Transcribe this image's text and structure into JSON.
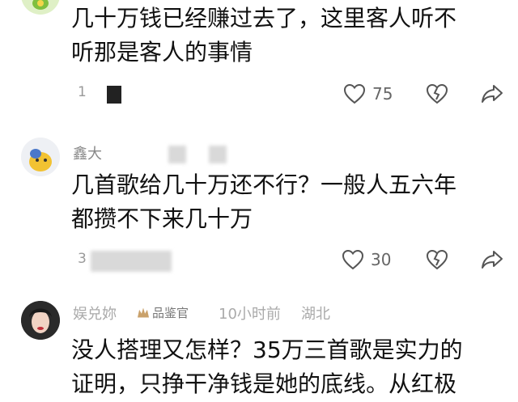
{
  "comments": [
    {
      "text_line1": "几十万钱已经赚过去了，这里客人听不",
      "text_line2": "听那是客人的事情",
      "meta_fragment": "1",
      "likes": "75"
    },
    {
      "username": "鑫大",
      "text_line1": "几首歌给几十万还不行？一般人五六年",
      "text_line2": "都攒不下来几十万",
      "meta_fragment": "3",
      "likes": "30"
    },
    {
      "username": "娱兑妳",
      "badge": "品鉴官",
      "time": "10小时前",
      "location": "湖北",
      "text_line1": "没人搭理又怎样？35万三首歌是实力的",
      "text_line2": "证明，只挣干净钱是她的底线。从红极"
    }
  ],
  "icons": {
    "like": "heart-icon",
    "dislike": "broken-heart-icon",
    "share": "share-arrow-icon"
  }
}
